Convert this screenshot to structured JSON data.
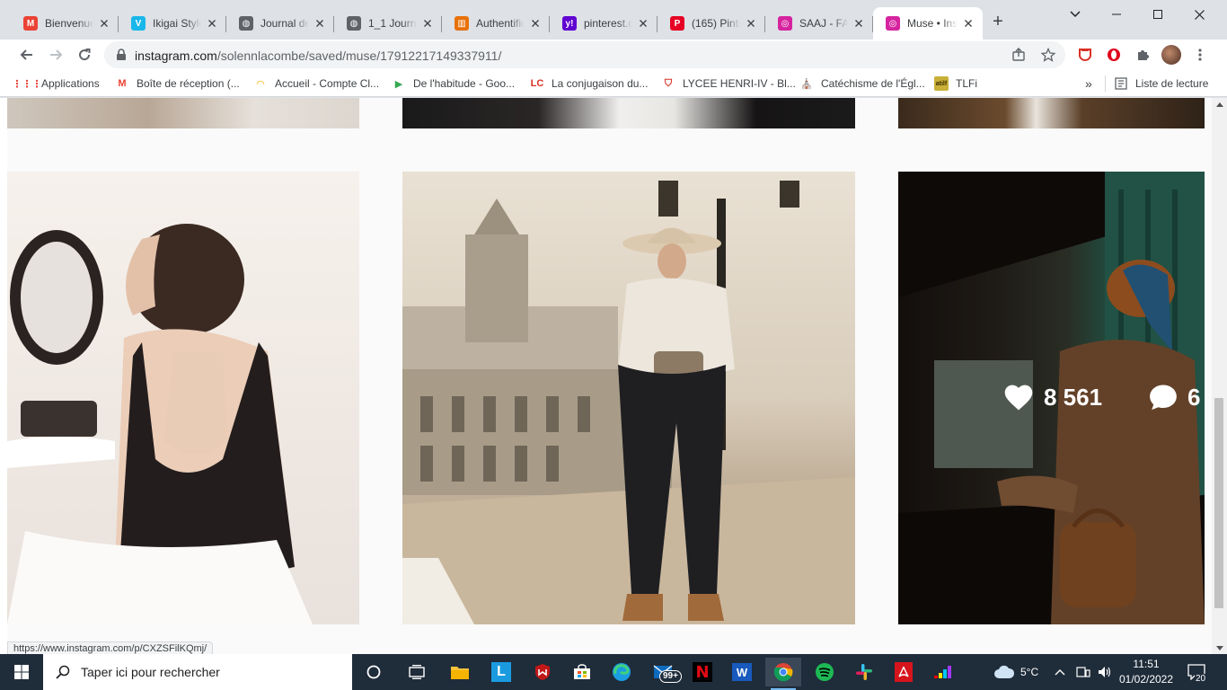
{
  "browser": {
    "tabs": [
      {
        "title": "Bienvenue",
        "favicon": "gmail-icon",
        "color": "#ea4335",
        "glyph": "M"
      },
      {
        "title": "Ikigai Style",
        "favicon": "vimeo-icon",
        "color": "#1ab7ea",
        "glyph": "V"
      },
      {
        "title": "Journal de",
        "favicon": "globe-icon",
        "color": "#5f6368",
        "glyph": "◍"
      },
      {
        "title": "1_1 Journa",
        "favicon": "globe-icon",
        "color": "#5f6368",
        "glyph": "◍"
      },
      {
        "title": "Authentific",
        "favicon": "chart-icon",
        "color": "#e8710a",
        "glyph": "▥"
      },
      {
        "title": "pinterest.c",
        "favicon": "yahoo-icon",
        "color": "#6001d2",
        "glyph": "y!"
      },
      {
        "title": "(165) Pinte",
        "favicon": "pinterest-icon",
        "color": "#e60023",
        "glyph": "P"
      },
      {
        "title": "SAAJ - FAI",
        "favicon": "instagram-icon",
        "color": "#d6249f",
        "glyph": "◎"
      },
      {
        "title": "Muse • Ins",
        "favicon": "instagram-icon",
        "color": "#d6249f",
        "glyph": "◎",
        "active": true
      }
    ],
    "new_tab_glyph": "+",
    "url": {
      "host": "instagram.com",
      "path": "/solennlacombe/saved/muse/17912217149337911/"
    }
  },
  "bookmarks": [
    {
      "label": "Applications",
      "icon": "apps-grid-icon",
      "color": "#ea4335",
      "glyph": "⋮⋮⋮"
    },
    {
      "label": "Boîte de réception (...",
      "icon": "gmail-icon",
      "color": "#ea4335",
      "glyph": "M"
    },
    {
      "label": "Accueil - Compte Cl...",
      "icon": "loop-icon",
      "color": "#f9ab00",
      "glyph": "◠"
    },
    {
      "label": "De l'habitude - Goo...",
      "icon": "play-store-icon",
      "color": "#34a853",
      "glyph": "▶"
    },
    {
      "label": "La conjugaison du...",
      "icon": "conjugaison-icon",
      "color": "#d93025",
      "glyph": "LC"
    },
    {
      "label": "LYCEE HENRI-IV - Bl...",
      "icon": "shield-red-icon",
      "color": "#d93025",
      "glyph": "⛉"
    },
    {
      "label": "Catéchisme de l'Égl...",
      "icon": "church-icon",
      "color": "#8d6e63",
      "glyph": "⛪"
    },
    {
      "label": "TLFi",
      "icon": "tlfi-icon",
      "color": "#c0a000",
      "glyph": "atilf"
    }
  ],
  "bookmarks_more": "»",
  "reading_list": "Liste de lecture",
  "page": {
    "hover_post": {
      "likes": "8 561",
      "comments": "6"
    },
    "status_url": "https://www.instagram.com/p/CXZSFilKQmj/"
  },
  "taskbar": {
    "search_placeholder": "Taper ici pour rechercher",
    "mail_badge": "99+",
    "weather": "5°C",
    "time": "11:51",
    "date": "01/02/2022",
    "notifications": "20"
  }
}
